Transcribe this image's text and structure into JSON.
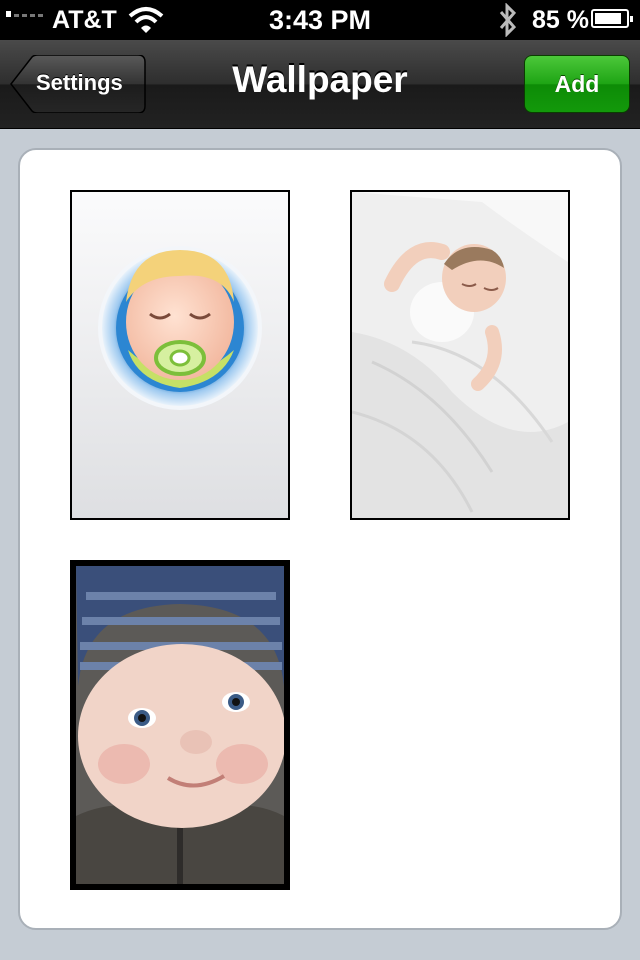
{
  "status_bar": {
    "carrier": "AT&T",
    "time": "3:43 PM",
    "battery_percent": "85 %",
    "battery_level": 0.85,
    "signal_bars": 1,
    "icons": [
      "signal-icon",
      "wifi-icon",
      "bluetooth-icon",
      "battery-icon"
    ]
  },
  "nav_bar": {
    "title": "Wallpaper",
    "back_label": "Settings",
    "add_label": "Add",
    "add_color": "#1ea414"
  },
  "wallpapers": [
    {
      "description_icon": "baby-pacifier-app-icon"
    },
    {
      "description_icon": "sleeping-baby-photo"
    },
    {
      "description_icon": "smiling-baby-photo"
    }
  ]
}
